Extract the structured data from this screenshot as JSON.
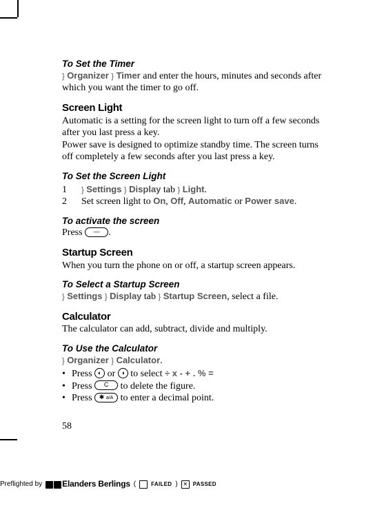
{
  "h_timer": "To Set the Timer",
  "arrow": "}",
  "m_organizer": "Organizer",
  "m_timer": "Timer",
  "body_timer": " and enter the hours, minutes and seconds after which you want the timer to go off.",
  "h_screenlight": "Screen Light",
  "body_screenlight1": "Automatic is a setting for the screen light to turn off a few seconds after you last press a key.",
  "body_screenlight2": "Power save is designed to optimize standby time. The screen turns off completely a few seconds after you last press a key.",
  "h_setscreenlight": "To Set the Screen Light",
  "step1_num": "1",
  "m_settings": "Settings",
  "m_display": "Display",
  "step1_tab": " tab ",
  "m_light": "Light",
  "period": ".",
  "step2_num": "2",
  "step2_a": "Set screen light to ",
  "m_on": "On",
  "comma_sp": ", ",
  "m_off": "Off",
  "m_automatic": "Automatic",
  "or_sp": " or ",
  "m_powersave": "Power save",
  "h_activate": "To activate the screen",
  "activate_press": "Press ",
  "h_startup": "Startup Screen",
  "body_startup": "When you turn the phone on or off, a startup screen appears.",
  "h_selectstartup": "To Select a Startup Screen",
  "m_startupscreen": "Startup Screen",
  "selectfile": ", select a file.",
  "h_calc": "Calculator",
  "body_calc": "The calculator can add, subtract, divide and multiply.",
  "h_usecalc": "To Use the Calculator",
  "m_calculator": "Calculator",
  "bul": "•",
  "calc_b1_a": "Press ",
  "calc_b1_or": " or ",
  "calc_b1_b": " to select ",
  "m_ops": "÷ x - + . % =",
  "calc_b2_a": "Press ",
  "btn_c": "C",
  "calc_b2_b": " to delete the figure.",
  "calc_b3_a": "Press ",
  "btn_star": "a/A",
  "calc_b3_b": " to enter a decimal point.",
  "pagenum": "58",
  "preflight_by": "Preflighted by",
  "brand": "Elanders Berlings",
  "paren_open": "(",
  "failed": "FAILED",
  "paren_close": ")",
  "passed": "PASSED",
  "x_mark": "✕"
}
